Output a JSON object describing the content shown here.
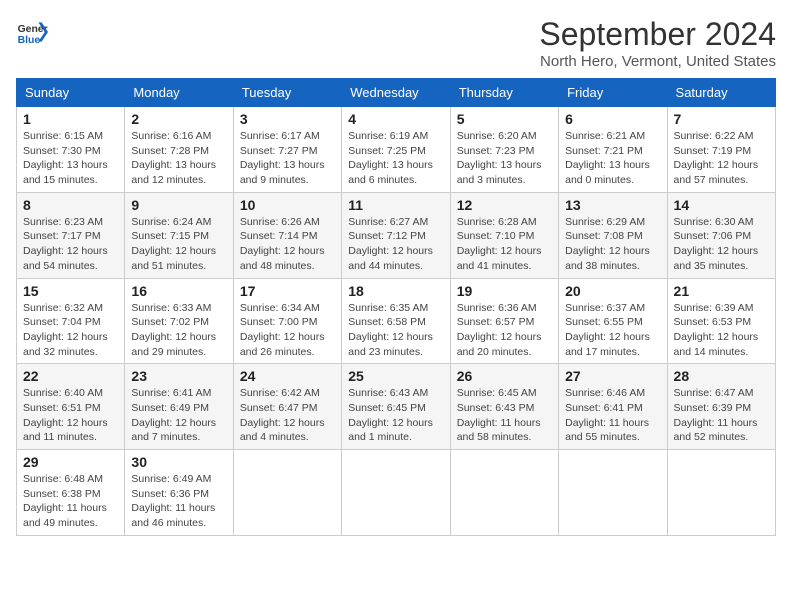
{
  "header": {
    "logo_line1": "General",
    "logo_line2": "Blue",
    "month_title": "September 2024",
    "location": "North Hero, Vermont, United States"
  },
  "weekdays": [
    "Sunday",
    "Monday",
    "Tuesday",
    "Wednesday",
    "Thursday",
    "Friday",
    "Saturday"
  ],
  "weeks": [
    [
      {
        "day": "1",
        "sunrise": "6:15 AM",
        "sunset": "7:30 PM",
        "daylight": "13 hours and 15 minutes."
      },
      {
        "day": "2",
        "sunrise": "6:16 AM",
        "sunset": "7:28 PM",
        "daylight": "13 hours and 12 minutes."
      },
      {
        "day": "3",
        "sunrise": "6:17 AM",
        "sunset": "7:27 PM",
        "daylight": "13 hours and 9 minutes."
      },
      {
        "day": "4",
        "sunrise": "6:19 AM",
        "sunset": "7:25 PM",
        "daylight": "13 hours and 6 minutes."
      },
      {
        "day": "5",
        "sunrise": "6:20 AM",
        "sunset": "7:23 PM",
        "daylight": "13 hours and 3 minutes."
      },
      {
        "day": "6",
        "sunrise": "6:21 AM",
        "sunset": "7:21 PM",
        "daylight": "13 hours and 0 minutes."
      },
      {
        "day": "7",
        "sunrise": "6:22 AM",
        "sunset": "7:19 PM",
        "daylight": "12 hours and 57 minutes."
      }
    ],
    [
      {
        "day": "8",
        "sunrise": "6:23 AM",
        "sunset": "7:17 PM",
        "daylight": "12 hours and 54 minutes."
      },
      {
        "day": "9",
        "sunrise": "6:24 AM",
        "sunset": "7:15 PM",
        "daylight": "12 hours and 51 minutes."
      },
      {
        "day": "10",
        "sunrise": "6:26 AM",
        "sunset": "7:14 PM",
        "daylight": "12 hours and 48 minutes."
      },
      {
        "day": "11",
        "sunrise": "6:27 AM",
        "sunset": "7:12 PM",
        "daylight": "12 hours and 44 minutes."
      },
      {
        "day": "12",
        "sunrise": "6:28 AM",
        "sunset": "7:10 PM",
        "daylight": "12 hours and 41 minutes."
      },
      {
        "day": "13",
        "sunrise": "6:29 AM",
        "sunset": "7:08 PM",
        "daylight": "12 hours and 38 minutes."
      },
      {
        "day": "14",
        "sunrise": "6:30 AM",
        "sunset": "7:06 PM",
        "daylight": "12 hours and 35 minutes."
      }
    ],
    [
      {
        "day": "15",
        "sunrise": "6:32 AM",
        "sunset": "7:04 PM",
        "daylight": "12 hours and 32 minutes."
      },
      {
        "day": "16",
        "sunrise": "6:33 AM",
        "sunset": "7:02 PM",
        "daylight": "12 hours and 29 minutes."
      },
      {
        "day": "17",
        "sunrise": "6:34 AM",
        "sunset": "7:00 PM",
        "daylight": "12 hours and 26 minutes."
      },
      {
        "day": "18",
        "sunrise": "6:35 AM",
        "sunset": "6:58 PM",
        "daylight": "12 hours and 23 minutes."
      },
      {
        "day": "19",
        "sunrise": "6:36 AM",
        "sunset": "6:57 PM",
        "daylight": "12 hours and 20 minutes."
      },
      {
        "day": "20",
        "sunrise": "6:37 AM",
        "sunset": "6:55 PM",
        "daylight": "12 hours and 17 minutes."
      },
      {
        "day": "21",
        "sunrise": "6:39 AM",
        "sunset": "6:53 PM",
        "daylight": "12 hours and 14 minutes."
      }
    ],
    [
      {
        "day": "22",
        "sunrise": "6:40 AM",
        "sunset": "6:51 PM",
        "daylight": "12 hours and 11 minutes."
      },
      {
        "day": "23",
        "sunrise": "6:41 AM",
        "sunset": "6:49 PM",
        "daylight": "12 hours and 7 minutes."
      },
      {
        "day": "24",
        "sunrise": "6:42 AM",
        "sunset": "6:47 PM",
        "daylight": "12 hours and 4 minutes."
      },
      {
        "day": "25",
        "sunrise": "6:43 AM",
        "sunset": "6:45 PM",
        "daylight": "12 hours and 1 minute."
      },
      {
        "day": "26",
        "sunrise": "6:45 AM",
        "sunset": "6:43 PM",
        "daylight": "11 hours and 58 minutes."
      },
      {
        "day": "27",
        "sunrise": "6:46 AM",
        "sunset": "6:41 PM",
        "daylight": "11 hours and 55 minutes."
      },
      {
        "day": "28",
        "sunrise": "6:47 AM",
        "sunset": "6:39 PM",
        "daylight": "11 hours and 52 minutes."
      }
    ],
    [
      {
        "day": "29",
        "sunrise": "6:48 AM",
        "sunset": "6:38 PM",
        "daylight": "11 hours and 49 minutes."
      },
      {
        "day": "30",
        "sunrise": "6:49 AM",
        "sunset": "6:36 PM",
        "daylight": "11 hours and 46 minutes."
      },
      null,
      null,
      null,
      null,
      null
    ]
  ],
  "labels": {
    "sunrise": "Sunrise:",
    "sunset": "Sunset:",
    "daylight": "Daylight:"
  }
}
